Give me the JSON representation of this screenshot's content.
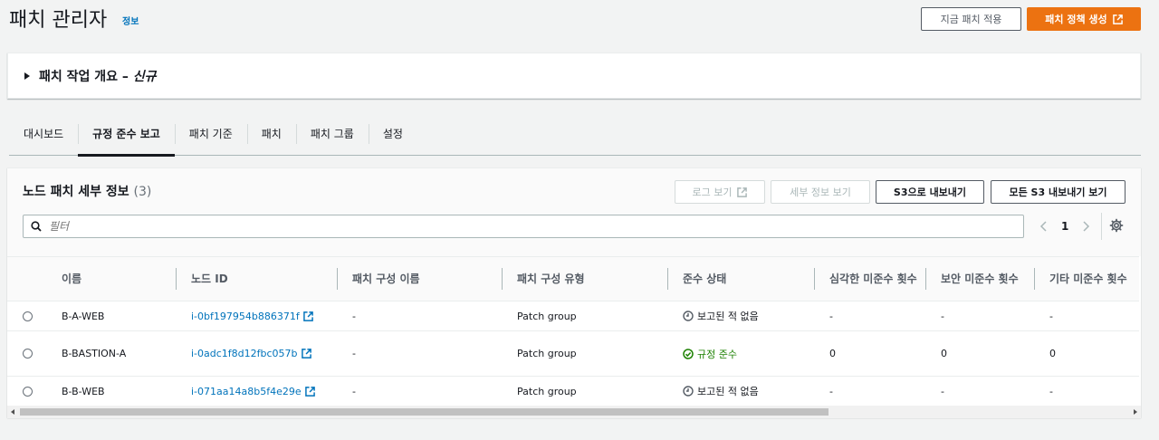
{
  "page": {
    "title": "패치 관리자",
    "info_link": "정보"
  },
  "header_buttons": {
    "apply_now": "지금 패치 적용",
    "create_policy": "패치 정책 생성"
  },
  "overview": {
    "title": "패치 작업 개요 –",
    "badge": "신규"
  },
  "tabs": [
    {
      "label": "대시보드",
      "active": false
    },
    {
      "label": "규정 준수 보고",
      "active": true
    },
    {
      "label": "패치 기준",
      "active": false
    },
    {
      "label": "패치",
      "active": false
    },
    {
      "label": "패치 그룹",
      "active": false
    },
    {
      "label": "설정",
      "active": false
    }
  ],
  "panel": {
    "title": "노드 패치 세부 정보",
    "count": "(3)",
    "buttons": {
      "view_logs": "로그 보기",
      "view_details": "세부 정보 보기",
      "export_s3": "S3으로 내보내기",
      "view_all_exports": "모든 S3 내보내기 보기"
    },
    "filter_placeholder": "필터",
    "page_number": "1"
  },
  "table": {
    "columns": [
      "이름",
      "노드 ID",
      "패치 구성 이름",
      "패치 구성 유형",
      "준수 상태",
      "심각한 미준수 횟수",
      "보안 미준수 횟수",
      "기타 미준수 횟수"
    ],
    "rows": [
      {
        "name": "B-A-WEB",
        "node_id": "i-0bf197954b886371f",
        "config_name": "-",
        "config_type": "Patch group",
        "status": "보고된 적 없음",
        "status_kind": "none",
        "critical": "-",
        "security": "-",
        "other": "-"
      },
      {
        "name": "B-BASTION-A",
        "node_id": "i-0adc1f8d12fbc057b",
        "config_name": "-",
        "config_type": "Patch group",
        "status": "규정 준수",
        "status_kind": "ok",
        "critical": "0",
        "security": "0",
        "other": "0"
      },
      {
        "name": "B-B-WEB",
        "node_id": "i-071aa14a8b5f4e29e",
        "config_name": "-",
        "config_type": "Patch group",
        "status": "보고된 적 없음",
        "status_kind": "none",
        "critical": "-",
        "security": "-",
        "other": "-"
      }
    ]
  },
  "colors": {
    "primary": "#ec7211",
    "link": "#0073bb",
    "success": "#1d8102"
  }
}
